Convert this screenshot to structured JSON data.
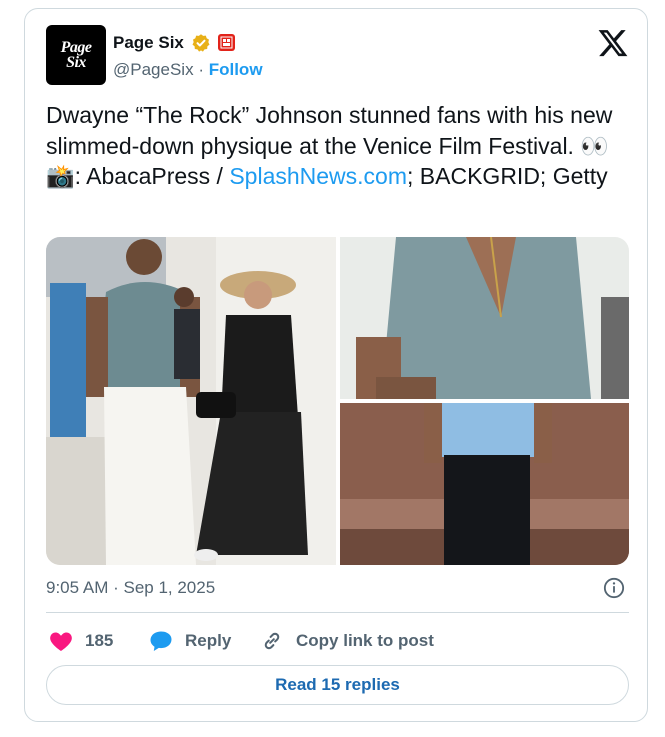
{
  "account": {
    "name": "Page Six",
    "handle": "@PageSix",
    "separator": "·",
    "follow_label": "Follow",
    "avatar_line1": "Page",
    "avatar_line2": "Six",
    "affiliate_badge": "PAGE SIX"
  },
  "post": {
    "text_part1": "Dwayne “The Rock” Johnson stunned fans with his new slimmed-down physique at the Venice Film Festival. 👀 📸: AbacaPress / ",
    "link_text": "SplashNews.com",
    "text_part2": "; BACKGRID; Getty",
    "timestamp": "9:05 AM · Sep 1, 2025"
  },
  "actions": {
    "like_count": "185",
    "reply_label": "Reply",
    "copy_label": "Copy link to post",
    "read_replies_label": "Read 15 replies"
  },
  "colors": {
    "accent": "#1d9bf0",
    "like": "#f91880",
    "muted": "#536471",
    "verified": "#e8b017"
  }
}
